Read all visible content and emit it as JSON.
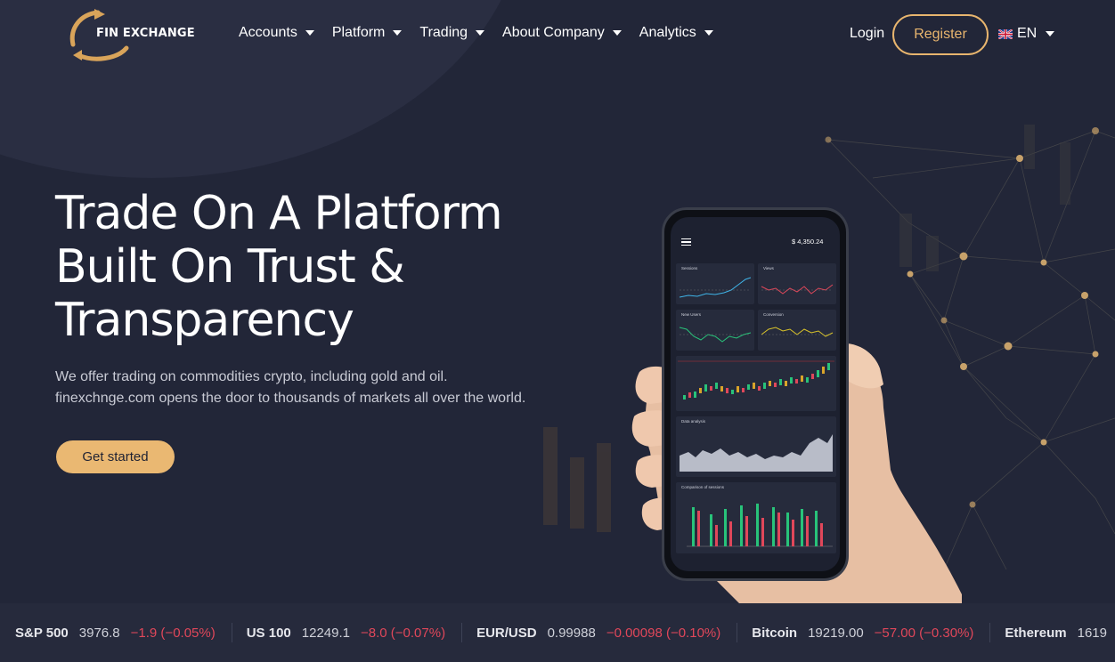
{
  "brand": {
    "name": "FIN EXCHANGE",
    "logo_icon": "circular-arrows-icon",
    "accent": "#e8b56e"
  },
  "nav": {
    "items": [
      {
        "label": "Accounts"
      },
      {
        "label": "Platform"
      },
      {
        "label": "Trading"
      },
      {
        "label": "About Company"
      },
      {
        "label": "Analytics"
      }
    ],
    "login_label": "Login",
    "register_label": "Register",
    "language": "EN"
  },
  "hero": {
    "title_lines": [
      "Trade On A Platform",
      "Built On Trust &",
      "Transparency"
    ],
    "subtitle_lines": [
      "We offer trading on commodities crypto, including gold and oil.",
      "finexchnge.com opens the door to thousands of markets all over the world."
    ],
    "cta_label": "Get started"
  },
  "phone": {
    "balance": "$ 4,350.24",
    "cards": [
      "Sessions",
      "Views",
      "New Users",
      "Conversion",
      "Data analysis",
      "Comparison of sessions"
    ]
  },
  "ticker": [
    {
      "symbol": "S&P 500",
      "price": "3976.8",
      "change": "−1.9 (−0.05%)"
    },
    {
      "symbol": "US 100",
      "price": "12249.1",
      "change": "−8.0 (−0.07%)"
    },
    {
      "symbol": "EUR/USD",
      "price": "0.99988",
      "change": "−0.00098 (−0.10%)"
    },
    {
      "symbol": "Bitcoin",
      "price": "19219.00",
      "change": "−57.00 (−0.30%)"
    },
    {
      "symbol": "Ethereum",
      "price": "1619",
      "change": ""
    }
  ],
  "colors": {
    "background": "#222638",
    "ticker_bg": "#262a3c",
    "negative": "#e0475a",
    "cta": "#eab872"
  }
}
